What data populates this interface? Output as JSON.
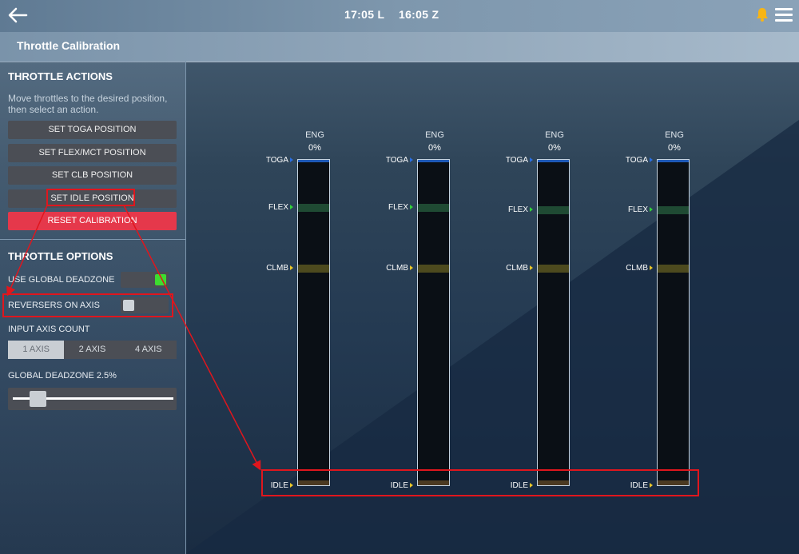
{
  "header": {
    "time_local": "17:05 L",
    "time_zulu": "16:05 Z",
    "back_icon": "arrow-left-icon",
    "notification_icon": "bell-icon",
    "menu_icon": "hamburger-menu-icon"
  },
  "page": {
    "title": "Throttle Calibration"
  },
  "actions": {
    "title": "THROTTLE ACTIONS",
    "hint": "Move throttles to the desired position, then select an action.",
    "buttons": {
      "toga": "SET TOGA POSITION",
      "flex": "SET FLEX/MCT POSITION",
      "clb": "SET CLB POSITION",
      "idle": "SET IDLE POSITION",
      "reset": "RESET CALIBRATION"
    }
  },
  "options": {
    "title": "THROTTLE OPTIONS",
    "global_deadzone_toggle": {
      "label": "USE GLOBAL DEADZONE",
      "on": true
    },
    "reversers_toggle": {
      "label": "REVERSERS ON AXIS",
      "on": false
    },
    "axis_count": {
      "label": "INPUT AXIS COUNT",
      "options": [
        "1 AXIS",
        "2 AXIS",
        "4 AXIS"
      ],
      "selected": "1 AXIS"
    },
    "deadzone_slider": {
      "label": "GLOBAL DEADZONE 2.5%",
      "value_percent": 2.5
    }
  },
  "engines": [
    {
      "name": "ENG",
      "percent": "0%"
    },
    {
      "name": "ENG",
      "percent": "0%"
    },
    {
      "name": "ENG",
      "percent": "0%"
    },
    {
      "name": "ENG",
      "percent": "0%"
    }
  ],
  "detent_labels": {
    "toga": "TOGA",
    "flex": "FLEX",
    "climb": "CLMB",
    "idle": "IDLE"
  },
  "colors": {
    "accent_red": "#e5384b",
    "toggle_on": "#3ddc2f",
    "flex_band": "#1f4a33",
    "climb_band": "#4d4a1e",
    "annotation_red": "#e0161d"
  }
}
